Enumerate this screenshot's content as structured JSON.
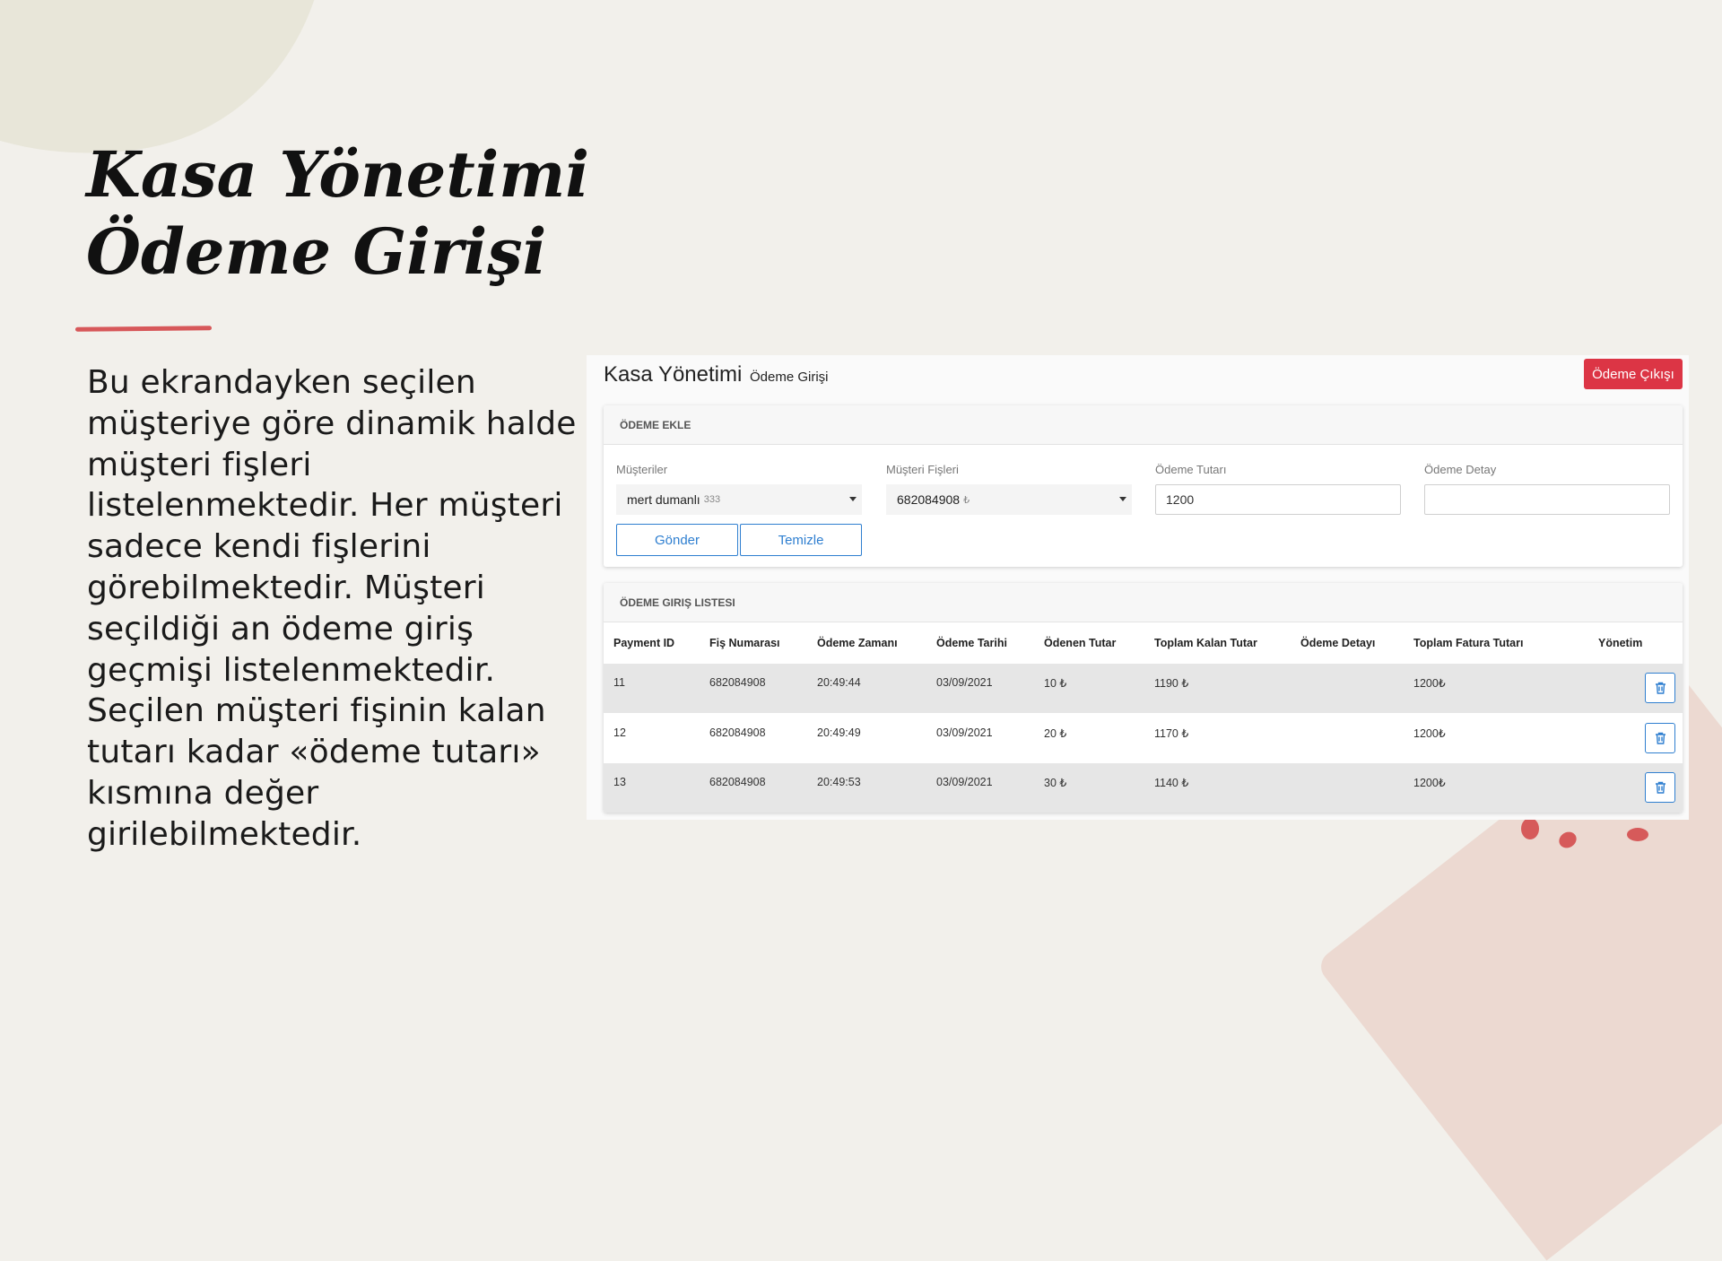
{
  "slide": {
    "title_line1": "Kasa Yönetimi",
    "title_line2": "Ödeme Girişi",
    "description": "Bu ekrandayken seçilen müşteriye göre dinamik halde müşteri fişleri listelenmektedir. Her müşteri sadece kendi fişlerini görebilmektedir. Müşteri seçildiği an ödeme giriş geçmişi listelenmektedir. Seçilen müşteri fişinin kalan tutarı kadar «ödeme tutarı» kısmına değer girilebilmektedir.",
    "accent_color": "#d7585a"
  },
  "app": {
    "title": "Kasa Yönetimi",
    "subtitle": "Ödeme Girişi",
    "exit_button": "Ödeme Çıkışı",
    "form": {
      "header": "ÖDEME EKLE",
      "customers_label": "Müşteriler",
      "customer_value": "mert dumanlı",
      "customer_code": "333",
      "receipts_label": "Müşteri Fişleri",
      "receipt_value": "682084908",
      "receipt_currency": "₺",
      "amount_label": "Ödeme Tutarı",
      "amount_value": "1200",
      "detail_label": "Ödeme Detay",
      "detail_value": "",
      "submit_button": "Gönder",
      "clear_button": "Temizle"
    },
    "list": {
      "header": "ÖDEME GIRIŞ LISTESI",
      "columns": [
        "Payment ID",
        "Fiş Numarası",
        "Ödeme Zamanı",
        "Ödeme Tarihi",
        "Ödenen Tutar",
        "Toplam Kalan Tutar",
        "Ödeme Detayı",
        "Toplam Fatura Tutarı",
        "Yönetim"
      ],
      "rows": [
        {
          "id": "11",
          "receipt": "682084908",
          "time": "20:49:44",
          "date": "03/09/2021",
          "paid": "10 ₺",
          "remaining": "1190 ₺",
          "detail": "",
          "total": "1200₺"
        },
        {
          "id": "12",
          "receipt": "682084908",
          "time": "20:49:49",
          "date": "03/09/2021",
          "paid": "20 ₺",
          "remaining": "1170 ₺",
          "detail": "",
          "total": "1200₺"
        },
        {
          "id": "13",
          "receipt": "682084908",
          "time": "20:49:53",
          "date": "03/09/2021",
          "paid": "30 ₺",
          "remaining": "1140 ₺",
          "detail": "",
          "total": "1200₺"
        }
      ],
      "delete_icon": "trash-icon"
    },
    "colors": {
      "danger": "#dc3545",
      "primary": "#2f7fd0"
    }
  }
}
